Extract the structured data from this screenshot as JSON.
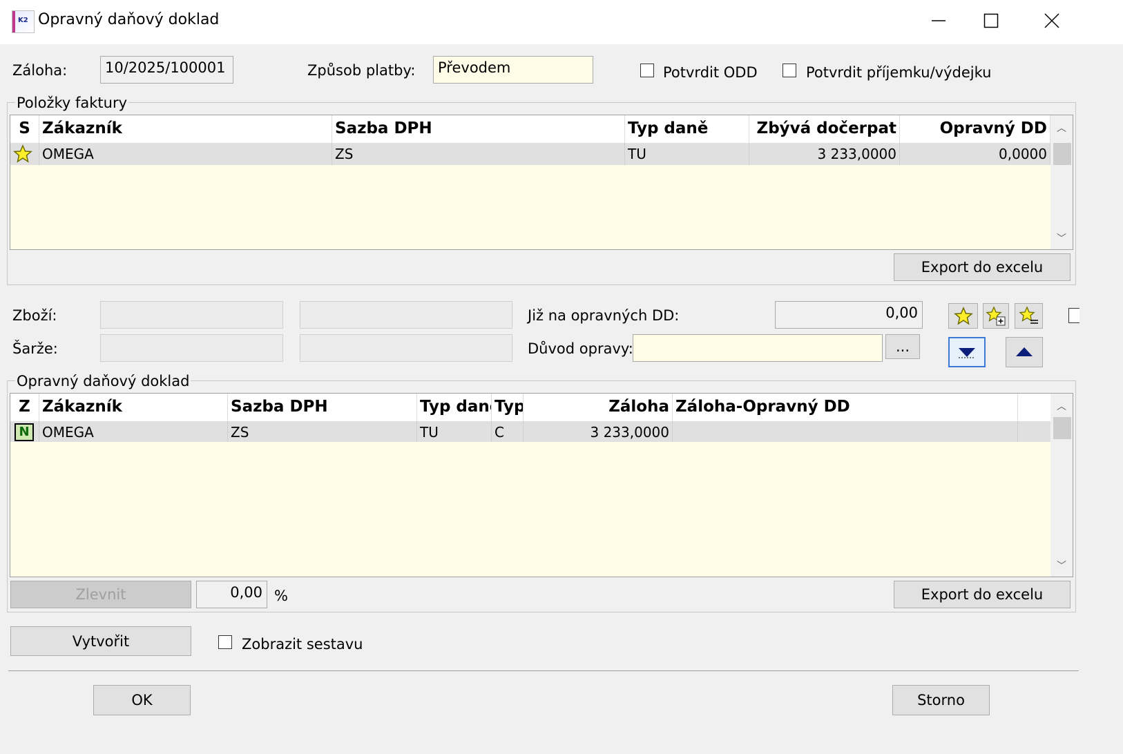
{
  "window": {
    "title": "Opravný daňový doklad"
  },
  "header": {
    "zaloha_label": "Záloha:",
    "zaloha_value": "10/2025/100001",
    "platba_label": "Způsob platby:",
    "platba_value": "Převodem",
    "potvrdit_odd": "Potvrdit ODD",
    "potvrdit_prijemku": "Potvrdit příjemku/výdejku"
  },
  "polozky": {
    "title": "Položky faktury",
    "columns": [
      "S",
      "Zákazník",
      "Sazba DPH",
      "Typ daně",
      "Zbývá dočerpat",
      "Opravný DD"
    ],
    "rows": [
      {
        "zakaznik": "OMEGA",
        "sazba": "ZS",
        "typ": "TU",
        "zbyva": "3 233,0000",
        "opravny": "0,0000"
      }
    ],
    "export_label": "Export do excelu"
  },
  "middle": {
    "zbozi_label": "Zboží:",
    "sarze_label": "Šarže:",
    "jiz_label": "Již na opravných DD:",
    "jiz_value": "0,00",
    "duvod_label": "Důvod opravy:",
    "duvod_value": "",
    "ellipsis": "..."
  },
  "opravny": {
    "title": "Opravný daňový doklad",
    "columns": [
      "Z",
      "Zákazník",
      "Sazba DPH",
      "Typ daně",
      "Typ",
      "Záloha",
      "Záloha-Opravný DD"
    ],
    "rows": [
      {
        "z": "N",
        "zakaznik": "OMEGA",
        "sazba": "ZS",
        "typ_dane": "TU",
        "typ": "C",
        "zaloha": "3 233,0000",
        "zaloha_opravny": ""
      }
    ],
    "zlevnit_label": "Zlevnit",
    "percent_value": "0,00",
    "percent_sign": "%",
    "export_label": "Export do excelu"
  },
  "footer": {
    "vytvorit_label": "Vytvořit",
    "zobrazit_label": "Zobrazit sestavu",
    "ok_label": "OK",
    "storno_label": "Storno"
  },
  "colors": {
    "yellow_bg": "#fffde7",
    "row_bg": "#e0e0e0",
    "arrow": "#0b1e7a"
  }
}
